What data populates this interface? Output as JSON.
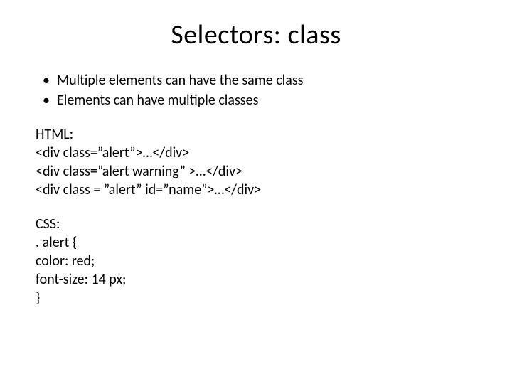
{
  "title": "Selectors: class",
  "bullets": [
    "Multiple elements can have the same class",
    "Elements can have multiple classes"
  ],
  "html_block": {
    "heading": "HTML:",
    "lines": [
      "<div class=”alert”>…</div>",
      "<div class=”alert warning” >…</div>",
      "<div class = ”alert” id=”name”>…</div>"
    ]
  },
  "css_block": {
    "heading": "CSS:",
    "lines": [
      ". alert {",
      "color: red;",
      "font-size: 14 px;",
      "}"
    ]
  }
}
